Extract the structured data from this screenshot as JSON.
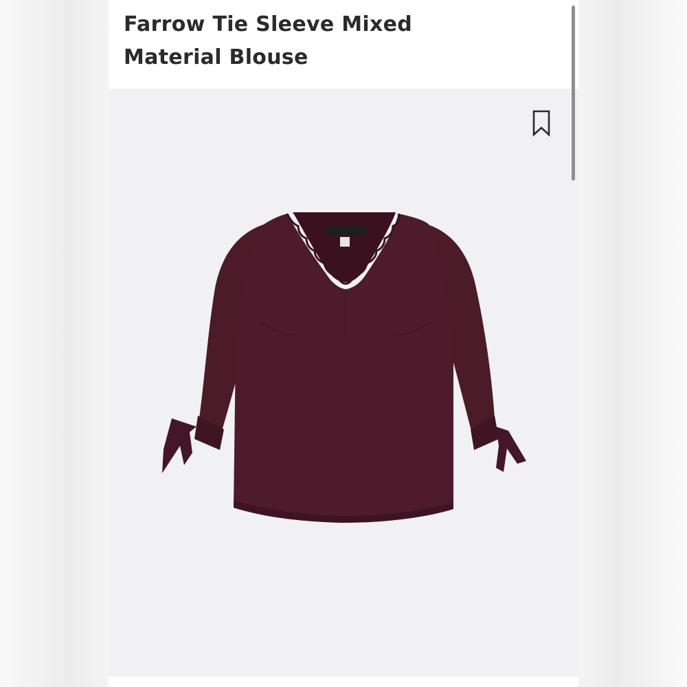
{
  "product": {
    "title_line1": "Farrow Tie Sleeve Mixed",
    "title_line2": "Material Blouse",
    "image_icon": "blouse-photo",
    "garment_color": "#4a1a28"
  },
  "actions": {
    "bookmark_icon": "bookmark-icon"
  },
  "colors": {
    "image_background": "#f1f1f3",
    "title_text": "#2b2b2b"
  }
}
